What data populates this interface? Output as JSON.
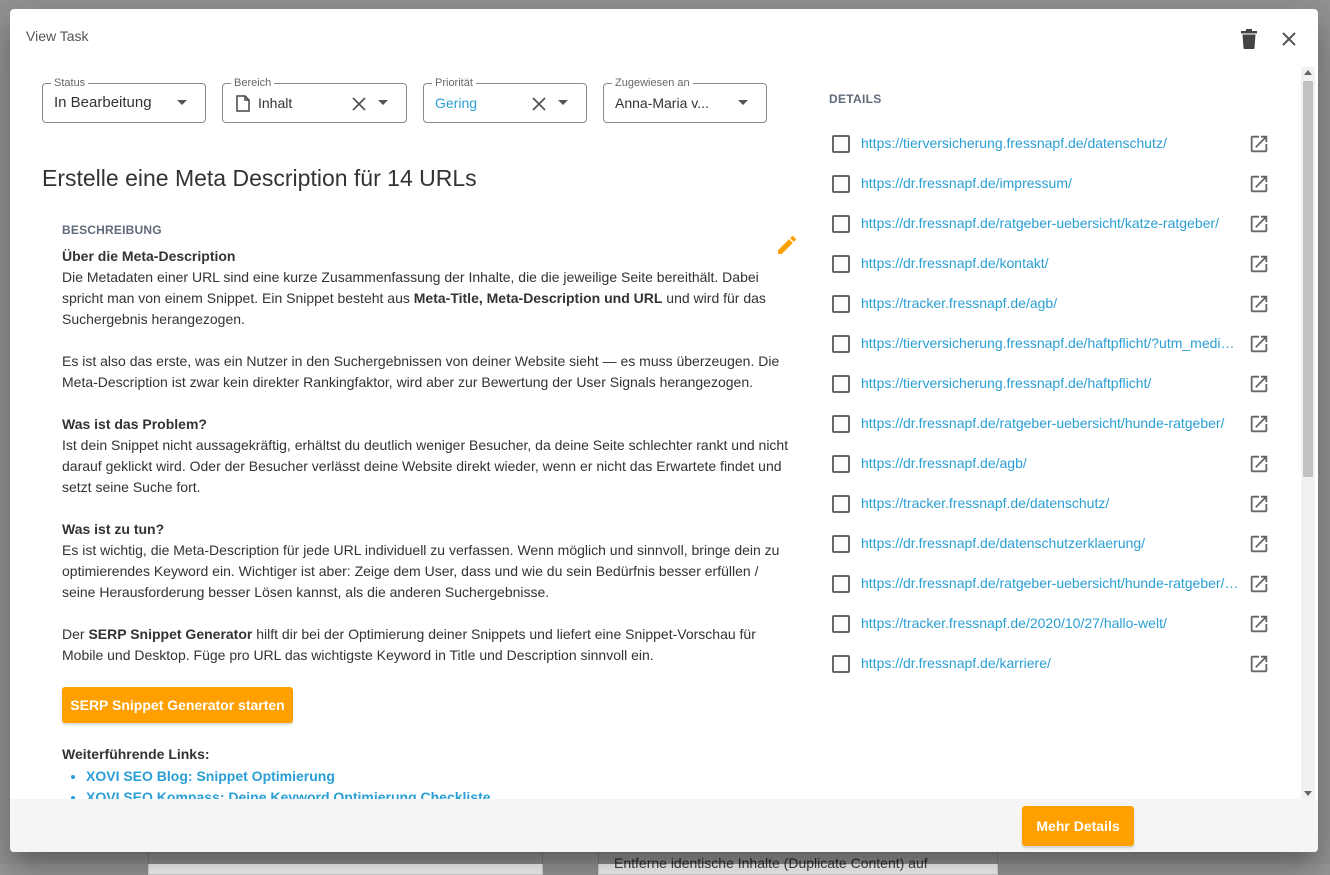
{
  "modal": {
    "title": "View Task"
  },
  "fields": {
    "status": {
      "label": "Status",
      "value": "In Bearbeitung"
    },
    "bereich": {
      "label": "Bereich",
      "value": "Inhalt"
    },
    "prioritaet": {
      "label": "Priorität",
      "value": "Gering"
    },
    "zugewiesen": {
      "label": "Zugewiesen an",
      "value": "Anna-Maria v..."
    }
  },
  "task": {
    "title": "Erstelle eine Meta Description für 14 URLs"
  },
  "description": {
    "heading": "BESCHREIBUNG",
    "p1_title": "Über die Meta-Description",
    "p1_a": "Die Metadaten einer URL sind eine kurze Zusammenfassung der Inhalte, die die jeweilige Seite bereithält. Dabei spricht man von einem Snippet. Ein Snippet besteht aus ",
    "p1_b": "Meta-Title, Meta-Description und URL",
    "p1_c": " und wird für das Suchergebnis herangezogen.",
    "p2": "Es ist also das erste, was ein Nutzer in den Suchergebnissen von deiner Website sieht — es muss überzeugen. Die Meta-Description ist zwar kein direkter Rankingfaktor, wird aber zur Bewertung der User Signals herangezogen.",
    "p3_title": "Was ist das Problem?",
    "p3": "Ist dein Snippet nicht aussagekräftig, erhältst du deutlich weniger Besucher, da deine Seite schlechter rankt und nicht darauf geklickt wird. Oder der Besucher verlässt deine Website direkt wieder, wenn er nicht das Erwartete findet und setzt seine Suche fort.",
    "p4_title": "Was ist zu tun?",
    "p4": "Es ist wichtig, die Meta-Description für jede URL individuell zu verfassen. Wenn möglich und sinnvoll, bringe dein zu optimierendes Keyword ein. Wichtiger ist aber: Zeige dem User, dass und wie du sein Bedürfnis besser erfüllen / seine Herausforderung besser Lösen kannst, als die anderen Suchergebnisse.",
    "p5_a": "Der ",
    "p5_b": "SERP Snippet Generator",
    "p5_c": " hilft dir bei der Optimierung deiner Snippets und liefert eine Snippet-Vorschau für Mobile und Desktop. Füge pro URL das wichtigste Keyword in Title und Description sinnvoll ein.",
    "button": "SERP Snippet Generator starten",
    "links_heading": "Weiterführende Links:",
    "links": [
      "XOVI SEO Blog: Snippet Optimierung",
      "XOVI SEO Kompass: Deine Keyword Optimierung Checkliste"
    ]
  },
  "details": {
    "heading": "DETAILS",
    "urls": [
      "https://tierversicherung.fressnapf.de/datenschutz/",
      "https://dr.fressnapf.de/impressum/",
      "https://dr.fressnapf.de/ratgeber-uebersicht/katze-ratgeber/",
      "https://dr.fressnapf.de/kontakt/",
      "https://tracker.fressnapf.de/agb/",
      "https://tierversicherung.fressnapf.de/haftpflicht/?utm_medium=referral",
      "https://tierversicherung.fressnapf.de/haftpflicht/",
      "https://dr.fressnapf.de/ratgeber-uebersicht/hunde-ratgeber/",
      "https://dr.fressnapf.de/agb/",
      "https://tracker.fressnapf.de/datenschutz/",
      "https://dr.fressnapf.de/datenschutzerklaerung/",
      "https://dr.fressnapf.de/ratgeber-uebersicht/hunde-ratgeber/welpen/",
      "https://tracker.fressnapf.de/2020/10/27/hallo-welt/",
      "https://dr.fressnapf.de/karriere/"
    ]
  },
  "footer": {
    "more_button": "Mehr Details"
  },
  "background": {
    "fragment": "Entferne identische Inhalte (Duplicate Content) auf"
  },
  "colors": {
    "accent": "#ffa000",
    "link": "#2a9fd6"
  }
}
